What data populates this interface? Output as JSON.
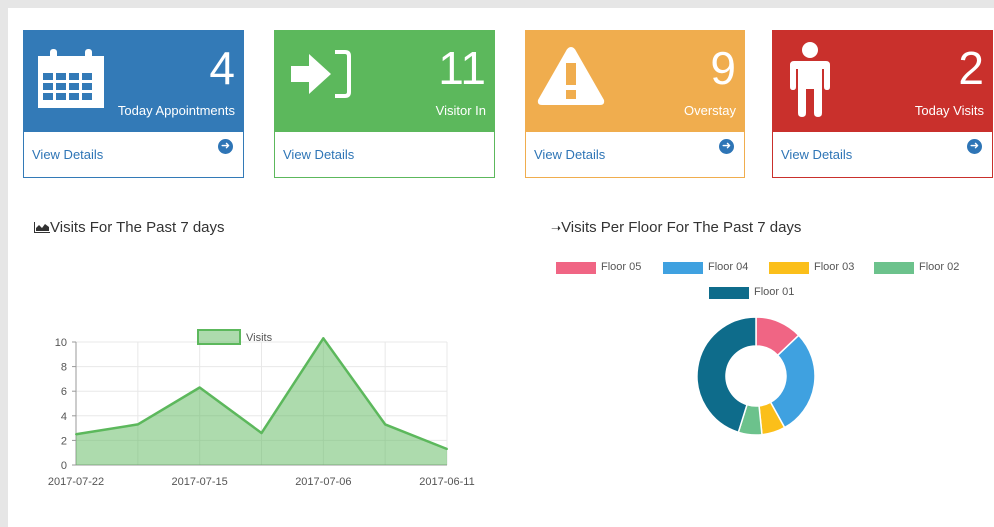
{
  "cards": [
    {
      "value": "4",
      "label": "Today Appointments",
      "link": "View Details",
      "color": "#337ab7",
      "icon": "calendar-icon",
      "show_arrow": true
    },
    {
      "value": "11",
      "label": "Visitor In",
      "link": "View Details",
      "color": "#5cb85c",
      "icon": "sign-in-icon",
      "show_arrow": false
    },
    {
      "value": "9",
      "label": "Overstay",
      "link": "View Details",
      "color": "#f0ad4e",
      "icon": "warning-icon",
      "show_arrow": true
    },
    {
      "value": "2",
      "label": "Today Visits",
      "link": "View Details",
      "color": "#c9302c",
      "icon": "person-icon",
      "show_arrow": true
    }
  ],
  "visits_section": {
    "title": "Visits For The Past 7 days",
    "icon": "area-chart-icon"
  },
  "floor_section": {
    "title": "Visits Per Floor For The Past 7 days",
    "icon": "arrow-right-icon"
  },
  "chart_data": [
    {
      "type": "area",
      "x": [
        "2017-07-22",
        "",
        "2017-07-15",
        "",
        "2017-07-06",
        "",
        "2017-06-11"
      ],
      "series": [
        {
          "name": "Visits",
          "values": [
            2.5,
            3.3,
            6.3,
            2.6,
            10.3,
            3.3,
            1.3
          ]
        }
      ],
      "ylim": [
        0,
        10
      ],
      "yticks": [
        0,
        2,
        4,
        6,
        8,
        10
      ],
      "xticklabels": [
        "2017-07-22",
        "2017-07-15",
        "2017-07-06",
        "2017-06-11"
      ],
      "legend": "top",
      "grid": true,
      "color": "#5cb85c"
    },
    {
      "type": "pie",
      "donut": true,
      "categories": [
        "Floor 05",
        "Floor 04",
        "Floor 03",
        "Floor 02",
        "Floor 01"
      ],
      "values": [
        2,
        4.5,
        1,
        1,
        7
      ],
      "colors": [
        "#f06584",
        "#3fa1e0",
        "#fbbf1a",
        "#6cc28c",
        "#0e6c8b"
      ],
      "legend": "top"
    }
  ]
}
